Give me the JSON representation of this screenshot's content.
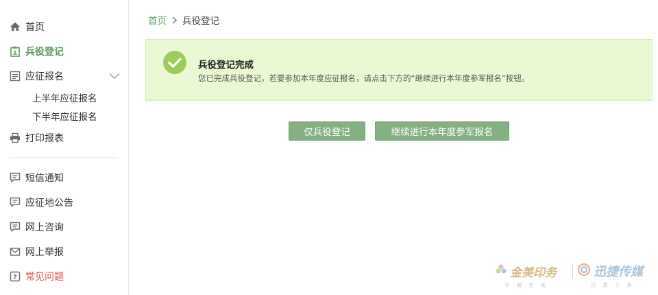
{
  "sidebar": {
    "items": [
      {
        "label": "首页",
        "icon": "home-icon"
      },
      {
        "label": "兵役登记",
        "icon": "clipboard-icon",
        "active": true
      },
      {
        "label": "应征报名",
        "icon": "document-icon",
        "expanded": true
      },
      {
        "label": "打印报表",
        "icon": "printer-icon"
      },
      {
        "label": "短信通知",
        "icon": "message-icon"
      },
      {
        "label": "应征地公告",
        "icon": "message-icon"
      },
      {
        "label": "网上咨询",
        "icon": "message-icon"
      },
      {
        "label": "网上举报",
        "icon": "envelope-icon"
      },
      {
        "label": "常见问题",
        "icon": "question-icon"
      }
    ],
    "subitems": [
      "上半年应征报名",
      "下半年应征报名"
    ]
  },
  "breadcrumb": {
    "home": "首页",
    "current": "兵役登记"
  },
  "notice": {
    "title": "兵役登记完成",
    "description": "您已完成兵役登记，若要参加本年度应征报名，请点击下方的“继续进行本年度参军报名”按钮。"
  },
  "buttons": {
    "only_registration": "仅兵役登记",
    "continue_enlist": "继续进行本年度参军报名"
  },
  "watermark": {
    "left_text": "金美印务",
    "left_sub": "专诚至美",
    "right_text": "迅捷传媒",
    "right_sub": "达意于美"
  },
  "colors": {
    "accent_green": "#5b9a5b",
    "button_green": "#84b084",
    "notice_bg": "#ebf8d4",
    "check_green": "#9ccc5a",
    "faq_red": "#d9534f"
  }
}
